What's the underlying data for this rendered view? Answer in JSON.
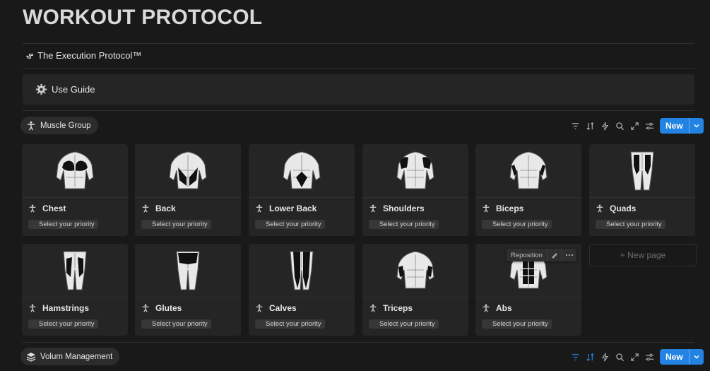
{
  "page_title": "WORKOUT PROTOCOL",
  "execution_link": "The Execution Protocol™",
  "use_guide": "Use Guide",
  "views": [
    {
      "label": "Muscle Group",
      "icon": "person-icon",
      "new_label": "New"
    },
    {
      "label": "Volum Management",
      "icon": "layers-icon",
      "new_label": "New"
    }
  ],
  "cards": [
    {
      "name": "Chest",
      "priority": "Select your priority"
    },
    {
      "name": "Back",
      "priority": "Select your priority"
    },
    {
      "name": "Lower Back",
      "priority": "Select your priority"
    },
    {
      "name": "Shoulders",
      "priority": "Select your priority"
    },
    {
      "name": "Biceps",
      "priority": "Select your priority"
    },
    {
      "name": "Quads",
      "priority": "Select your priority"
    },
    {
      "name": "Hamstrings",
      "priority": "Select your priority"
    },
    {
      "name": "Glutes",
      "priority": "Select your priority"
    },
    {
      "name": "Calves",
      "priority": "Select your priority"
    },
    {
      "name": "Triceps",
      "priority": "Select your priority"
    },
    {
      "name": "Abs",
      "priority": "Select your priority"
    }
  ],
  "hover_toolbar": {
    "reposition": "Reposition"
  },
  "new_page": "+ New page",
  "colors": {
    "accent": "#2383e2",
    "background": "#191919",
    "card": "#252525"
  }
}
